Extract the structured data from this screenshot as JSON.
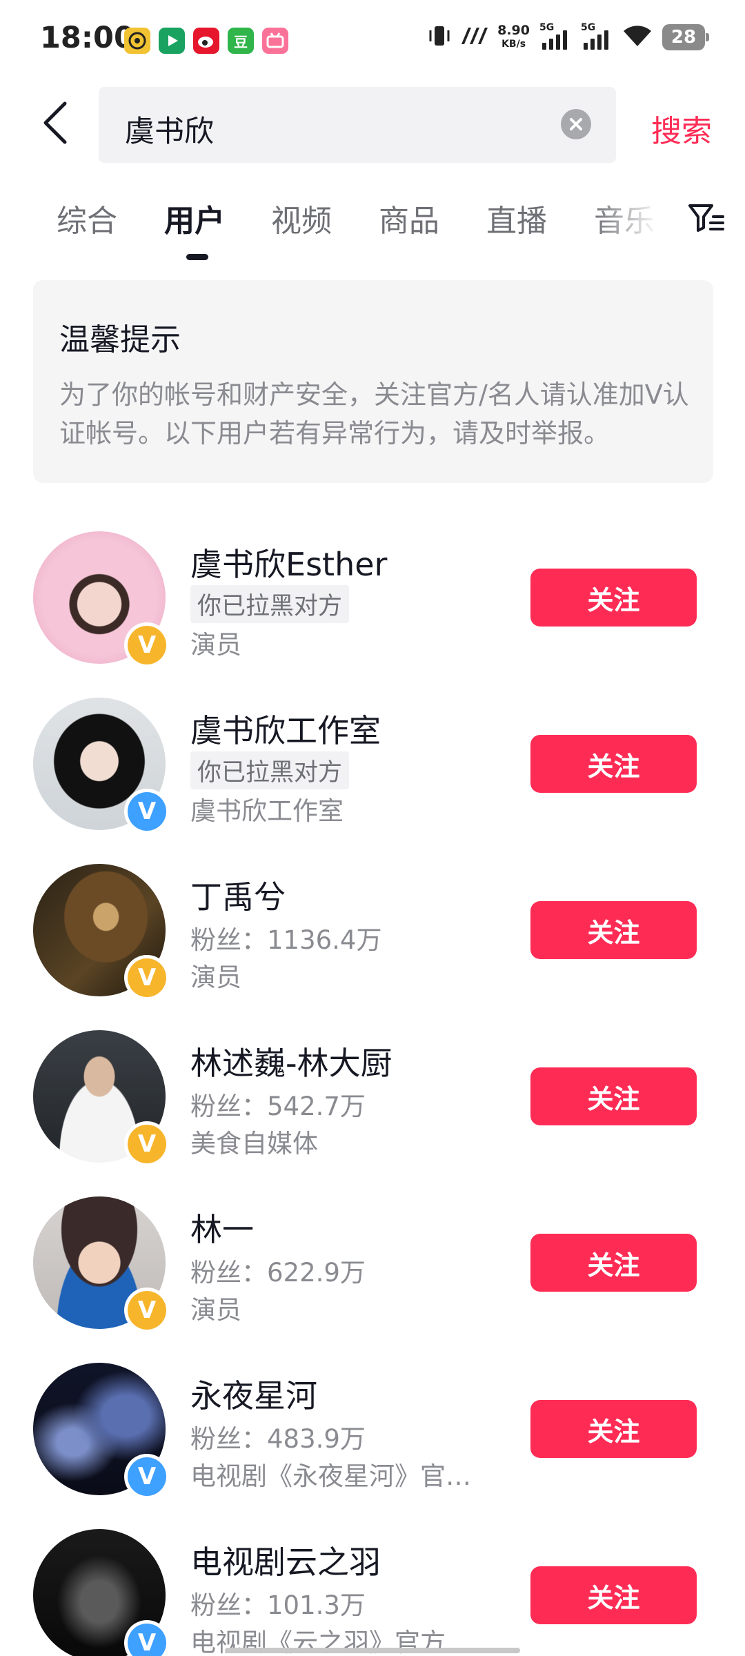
{
  "status_bar": {
    "time": "18:00",
    "net_speed_value": "8.90",
    "net_speed_unit": "KB/s",
    "sim1_label": "5G",
    "sim2_label": "5G",
    "battery": "28",
    "app_icons": [
      {
        "name": "browser-icon",
        "color": "#f1c232"
      },
      {
        "name": "video-app-icon",
        "color": "#1aa260"
      },
      {
        "name": "weibo-icon",
        "color": "#e6162d"
      },
      {
        "name": "douban-icon",
        "color": "#2fb54a",
        "glyph": "豆"
      },
      {
        "name": "bilibili-icon",
        "color": "#fb7299"
      }
    ]
  },
  "search": {
    "query": "虞书欣",
    "submit_label": "搜索"
  },
  "tabs": [
    {
      "label": "综合",
      "active": false
    },
    {
      "label": "用户",
      "active": true
    },
    {
      "label": "视频",
      "active": false
    },
    {
      "label": "商品",
      "active": false
    },
    {
      "label": "直播",
      "active": false
    },
    {
      "label": "音乐",
      "active": false
    }
  ],
  "notice": {
    "title": "温馨提示",
    "body": "为了你的帐号和财产安全，关注官方/名人请认准加V认证帐号。以下用户若有异常行为，请及时举报。"
  },
  "follow_label": "关注",
  "users": [
    {
      "name": "虞书欣Esther",
      "line1": "你已拉黑对方",
      "line1_is_tag": true,
      "line2": "演员",
      "badge": "gold"
    },
    {
      "name": "虞书欣工作室",
      "line1": "你已拉黑对方",
      "line1_is_tag": true,
      "line2": "虞书欣工作室",
      "badge": "blue"
    },
    {
      "name": "丁禹兮",
      "line1": "粉丝：1136.4万",
      "line1_is_tag": false,
      "line2": "演员",
      "badge": "gold"
    },
    {
      "name": "林述巍-林大厨",
      "line1": "粉丝：542.7万",
      "line1_is_tag": false,
      "line2": "美食自媒体",
      "badge": "gold"
    },
    {
      "name": "林一",
      "line1": "粉丝：622.9万",
      "line1_is_tag": false,
      "line2": "演员",
      "badge": "gold"
    },
    {
      "name": "永夜星河",
      "line1": "粉丝：483.9万",
      "line1_is_tag": false,
      "line2": "电视剧《永夜星河》官…",
      "badge": "blue"
    },
    {
      "name": "电视剧云之羽",
      "line1": "粉丝：101.3万",
      "line1_is_tag": false,
      "line2": "电视剧《云之羽》官方…",
      "badge": "blue"
    }
  ],
  "badge_glyph": "V",
  "colors": {
    "accent": "#fe2c55",
    "badge_gold": "#f7b52c",
    "badge_blue": "#3ea0ff"
  }
}
